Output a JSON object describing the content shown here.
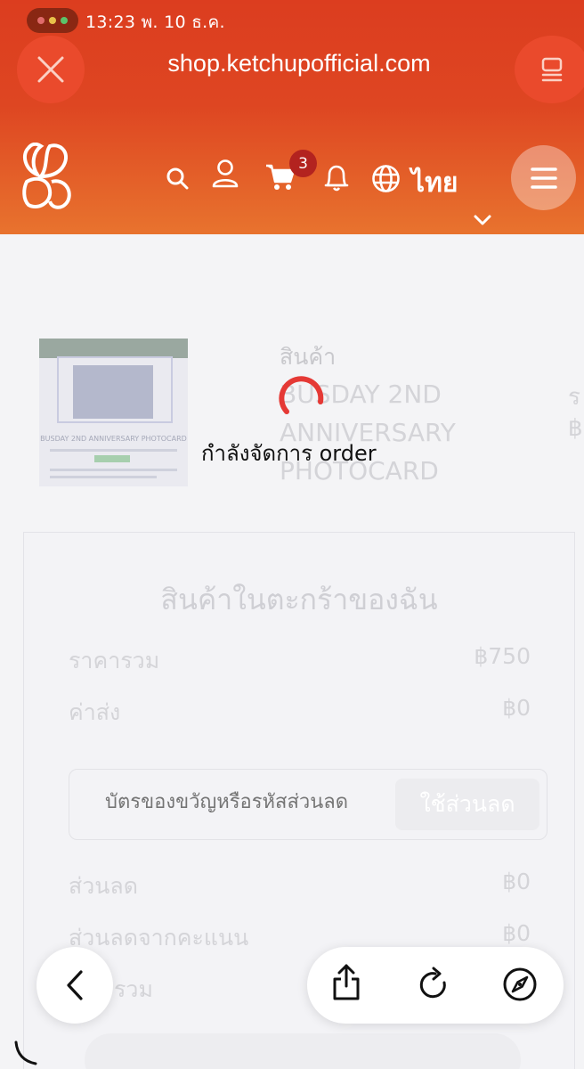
{
  "status_bar": {
    "time_date": "13:23  พ. 10 ธ.ค.",
    "dots": [
      "#e06b6b",
      "#e8c14a",
      "#5bc46a"
    ]
  },
  "browser": {
    "url": "shop.ketchupofficial.com",
    "close_icon": "close-icon",
    "tabs_icon": "tabs-icon"
  },
  "site_header": {
    "logo_icon": "ketchup-logo",
    "icons": [
      "search-icon",
      "user-icon",
      "cart-icon",
      "bell-icon",
      "globe-icon"
    ],
    "cart_count": "3",
    "language": "ไทย",
    "menu_icon": "hamburger-icon",
    "chevron_icon": "chevron-down-icon"
  },
  "product": {
    "column_header": "สินค้า",
    "name": "BUSDAY 2ND ANNIVERSARY PHOTOCARD",
    "col2_partial": "ร",
    "col3_partial": "฿",
    "image_caption": "BUSDAY 2ND ANNIVERSARY PHOTOCARD"
  },
  "cart_summary": {
    "title": "สินค้าในตะกร้าของฉัน",
    "subtotal_label": "ราคารวม",
    "subtotal_value": "฿750",
    "shipping_label": "ค่าส่ง",
    "shipping_value": "฿0",
    "coupon_placeholder": "บัตรของขวัญหรือรหัสส่วนลด",
    "coupon_button": "ใช้ส่วนลด",
    "discount_label": "ส่วนลด",
    "discount_value": "฿0",
    "points_discount_label": "ส่วนลดจากคะแนน",
    "points_discount_value": "฿0",
    "total_label_partial": "รวม"
  },
  "loading": {
    "text": "กำลังจัดการ order",
    "accent": "#e53935"
  },
  "bottom_nav": {
    "back_icon": "back-icon",
    "share_icon": "share-icon",
    "reload_icon": "reload-icon",
    "compass_icon": "compass-icon"
  }
}
